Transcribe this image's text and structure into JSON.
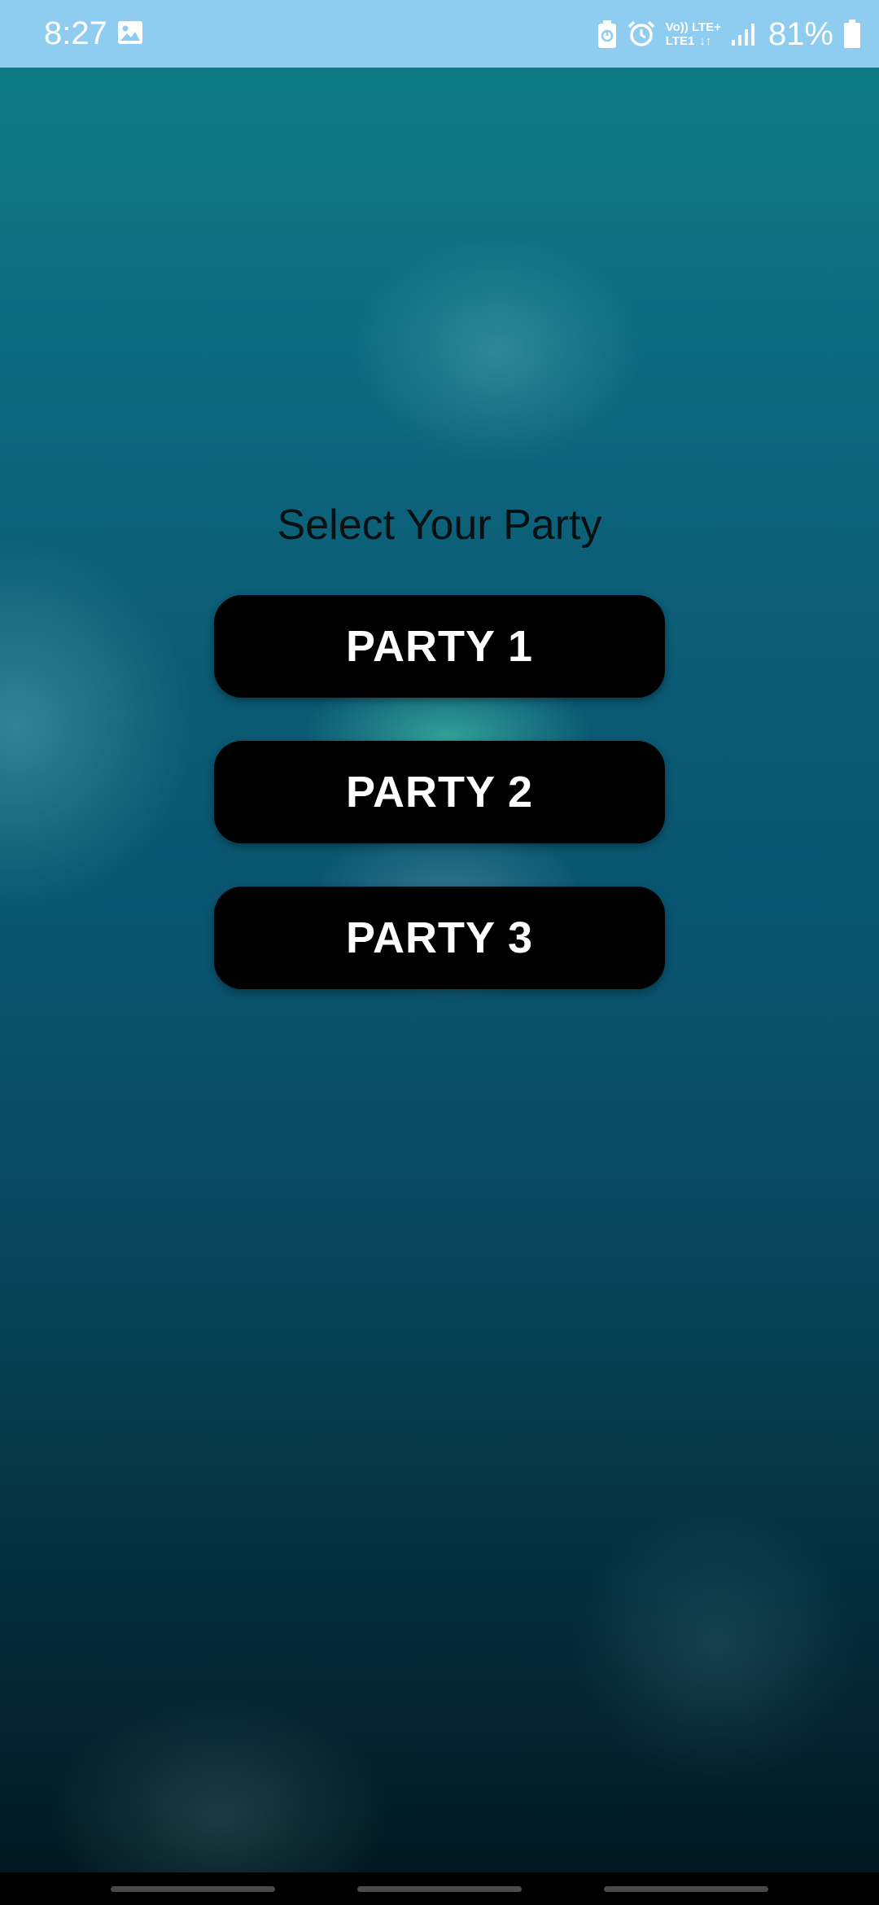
{
  "status_bar": {
    "time": "8:27",
    "network_top": "Vo)) LTE+",
    "network_bottom_left": "LTE1",
    "network_bottom_right": "↓↑",
    "battery": "81%",
    "icons": [
      "gallery-icon",
      "battery-saver-icon",
      "alarm-icon",
      "signal-icon",
      "battery-icon"
    ]
  },
  "main": {
    "title": "Select Your Party",
    "buttons": [
      {
        "label": "PARTY 1"
      },
      {
        "label": "PARTY 2"
      },
      {
        "label": "PARTY 3"
      }
    ]
  },
  "colors": {
    "status_bar": "#8fcdf0",
    "button_bg": "#000000",
    "button_text": "#ffffff",
    "title_text": "#0a0f12"
  }
}
